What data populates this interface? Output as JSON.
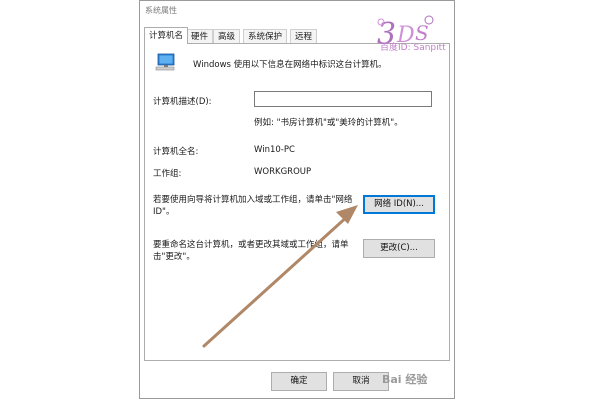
{
  "window": {
    "title": "系统属性"
  },
  "tabs": [
    {
      "label": "计算机名",
      "active": true
    },
    {
      "label": "硬件",
      "active": false
    },
    {
      "label": "高级",
      "active": false
    },
    {
      "label": "系统保护",
      "active": false
    },
    {
      "label": "远程",
      "active": false
    }
  ],
  "panel": {
    "intro": "Windows 使用以下信息在网络中标识这台计算机。",
    "description_label": "计算机描述(D):",
    "description_value": "",
    "example": "例如: \"书房计算机\"或\"美玲的计算机\"。",
    "fullname_label": "计算机全名:",
    "fullname_value": "Win10-PC",
    "workgroup_label": "工作组:",
    "workgroup_value": "WORKGROUP",
    "network_text": "若要使用向导将计算机加入域或工作组，请单击\"网络 ID\"。",
    "network_button": "网络 ID(N)...",
    "rename_text": "要重命名这台计算机，或者更改其域或工作组，请单击\"更改\"。",
    "rename_button": "更改(C)..."
  },
  "footer": {
    "ok": "确定",
    "cancel": "取消"
  },
  "watermark": {
    "top": "百度ID: Sanpitt",
    "bottom": "Bai 经验"
  },
  "colors": {
    "arrow": "#b08868",
    "focus": "#0078d7",
    "watermark": "#c080c8"
  }
}
